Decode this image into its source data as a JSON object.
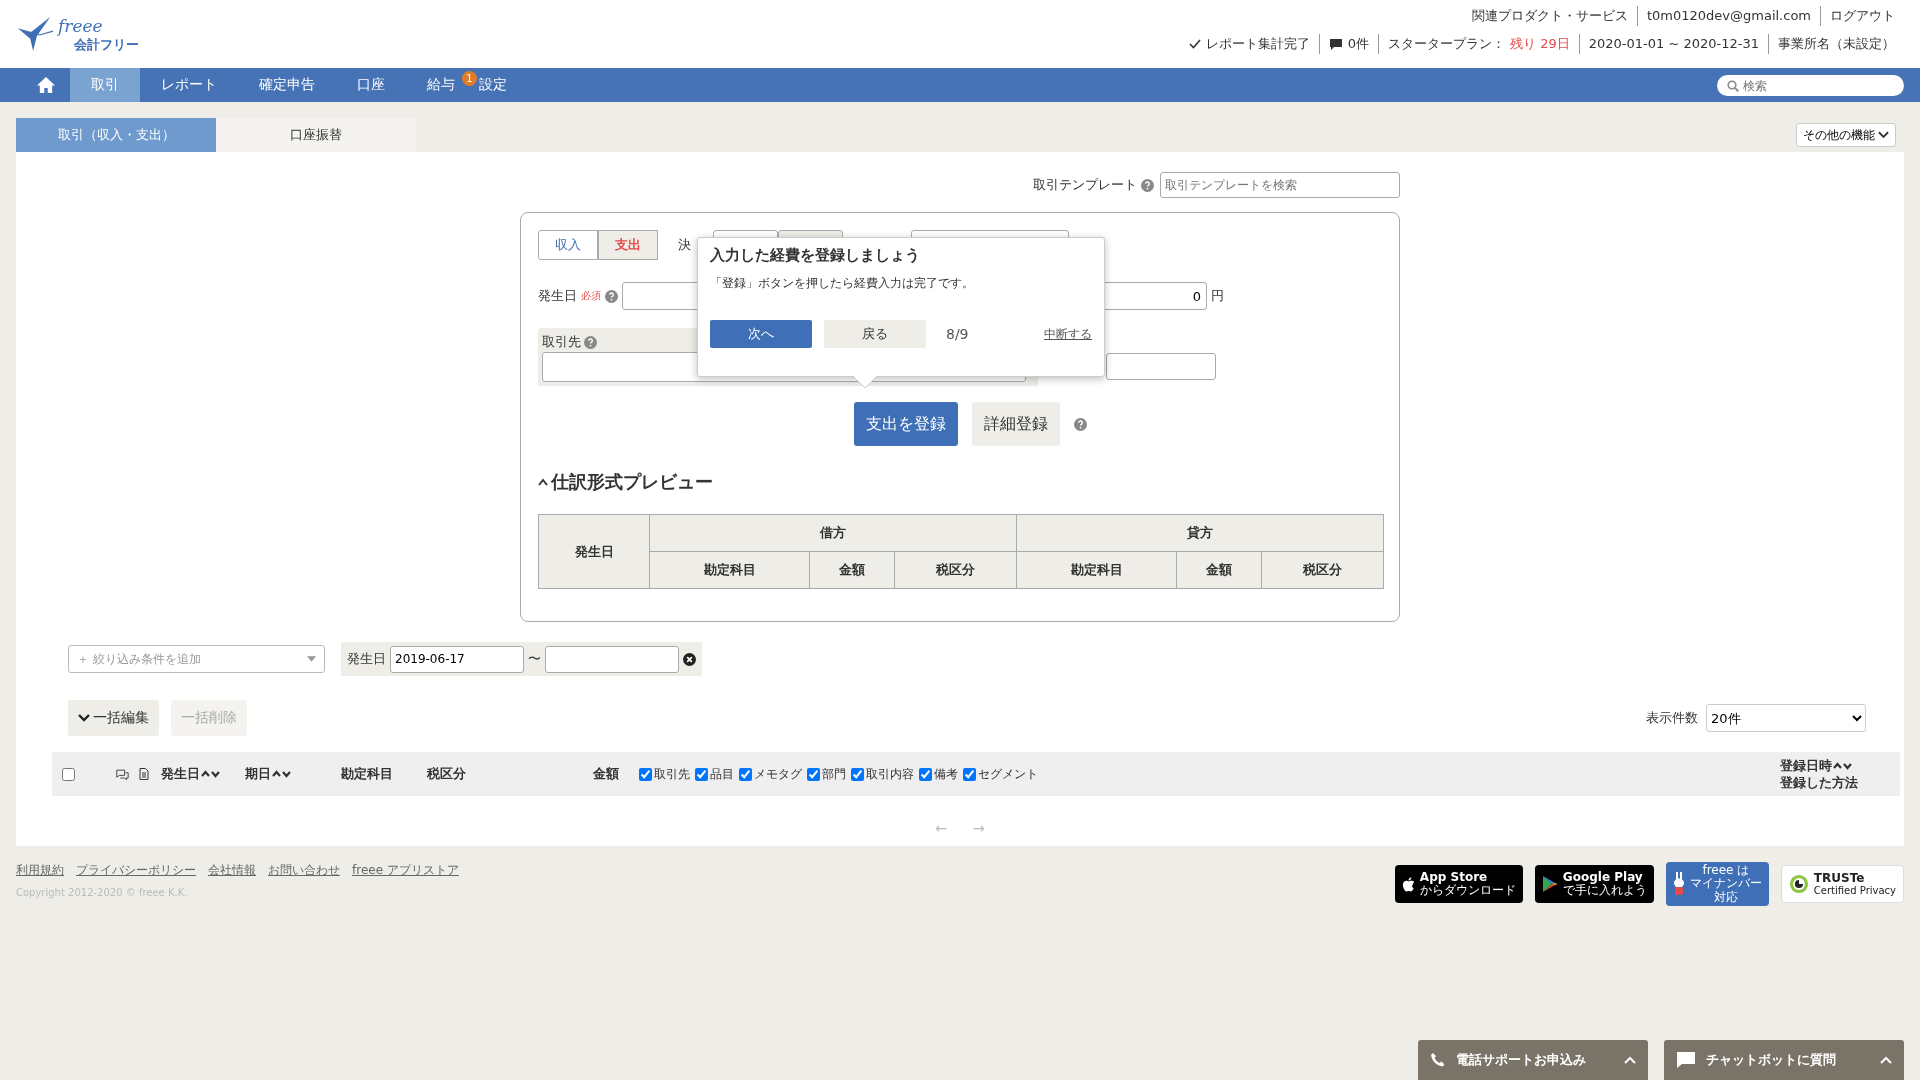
{
  "header": {
    "logo": {
      "script": "freee",
      "name": "会計フリー"
    },
    "top_links": [
      "関連プロダクト・サービス",
      "t0m0120dev@gmail.com",
      "ログアウト"
    ],
    "status_items": [
      {
        "kind": "check",
        "text": "レポート集計完了"
      },
      {
        "kind": "comment",
        "text": "0件"
      },
      {
        "kind": "plan",
        "text": "スタータープラン：",
        "highlight": "残り 29日"
      },
      {
        "kind": "plain",
        "text": "2020-01-01 ~ 2020-12-31"
      },
      {
        "kind": "plain",
        "text": "事業所名（未設定）"
      }
    ]
  },
  "nav": {
    "items": [
      {
        "kind": "home",
        "selected": false
      },
      {
        "kind": "text",
        "label": "取引",
        "selected": true
      },
      {
        "kind": "text",
        "label": "レポート",
        "selected": false
      },
      {
        "kind": "text",
        "label": "確定申告",
        "selected": false
      },
      {
        "kind": "text",
        "label": "口座",
        "selected": false
      },
      {
        "kind": "text",
        "label": "給与",
        "selected": false
      },
      {
        "kind": "text",
        "label": "設定",
        "selected": false,
        "badge": "1"
      }
    ],
    "search": {
      "placeholder": "検索"
    }
  },
  "tabs": [
    {
      "label": "取引（収入・支出）",
      "selected": true
    },
    {
      "label": "口座振替",
      "selected": false
    }
  ],
  "more_button": "その他の機能",
  "template": {
    "label": "取引テンプレート",
    "placeholder": "取引テンプレートを検索"
  },
  "form": {
    "type_toggle": [
      {
        "label": "収入",
        "selected": false
      },
      {
        "label": "支出",
        "selected": true
      }
    ],
    "settlement_label": "決",
    "date_label": "発生日",
    "required": "必須",
    "amount": "0",
    "currency": "円",
    "partner_label": "取引先",
    "submit": "支出を登録",
    "detail": "詳細登録"
  },
  "popover": {
    "title": "入力した経費を登録しましょう",
    "body": "「登録」ボタンを押したら経費入力は完了です。",
    "next": "次へ",
    "back": "戻る",
    "step": "8/9",
    "quit": "中断する"
  },
  "preview": {
    "title": "仕訳形式プレビュー",
    "expanded": true,
    "date_header": "発生日",
    "groups": [
      {
        "label": "借方",
        "columns": [
          "勘定科目",
          "金額",
          "税区分"
        ]
      },
      {
        "label": "貸方",
        "columns": [
          "勘定科目",
          "金額",
          "税区分"
        ]
      }
    ]
  },
  "filter": {
    "placeholder": "＋ 絞り込み条件を追加",
    "date_label": "発生日",
    "from": "2019-06-17",
    "tilde": "〜"
  },
  "bulk": [
    {
      "label": "一括編集",
      "disabled": false
    },
    {
      "label": "一括削除",
      "disabled": true
    }
  ],
  "per_page": {
    "label": "表示件数",
    "value": "20件"
  },
  "list_header": {
    "checked": false,
    "columns": [
      {
        "label": "発生日",
        "sortable": true
      },
      {
        "label": "期日",
        "sortable": true
      },
      {
        "label": "勘定科目",
        "sortable": false
      },
      {
        "label": "税区分",
        "sortable": false
      },
      {
        "label": "金額",
        "sortable": false
      }
    ],
    "toggles": [
      {
        "label": "取引先",
        "checked": true
      },
      {
        "label": "品目",
        "checked": true
      },
      {
        "label": "メモタグ",
        "checked": true
      },
      {
        "label": "部門",
        "checked": true
      },
      {
        "label": "取引内容",
        "checked": true
      },
      {
        "label": "備考",
        "checked": true
      },
      {
        "label": "セグメント",
        "checked": true
      }
    ],
    "right": {
      "label": "登録日時",
      "sub": "登録した方法"
    }
  },
  "pagination": [
    "←",
    "→"
  ],
  "footer": {
    "links": [
      "利用規約",
      "プライバシーポリシー",
      "会社情報",
      "お問い合わせ",
      "freee アプリストア"
    ],
    "copyright": "Copyright 2012-2020 © freee K.K.",
    "badges": [
      {
        "kind": "appstore",
        "lines": [
          "App Store",
          "からダウンロード"
        ]
      },
      {
        "kind": "googleplay",
        "lines": [
          "Google Play",
          "で手に入れよう"
        ]
      },
      {
        "kind": "mynumber",
        "lines": [
          "freee は",
          "マイナンバー",
          "対応"
        ]
      },
      {
        "kind": "truste",
        "lines": [
          "TRUSTe",
          "Certified Privacy"
        ]
      }
    ]
  },
  "support": [
    {
      "kind": "phone",
      "label": "電話サポートお申込み"
    },
    {
      "kind": "chat",
      "label": "チャットボットに質問"
    }
  ]
}
